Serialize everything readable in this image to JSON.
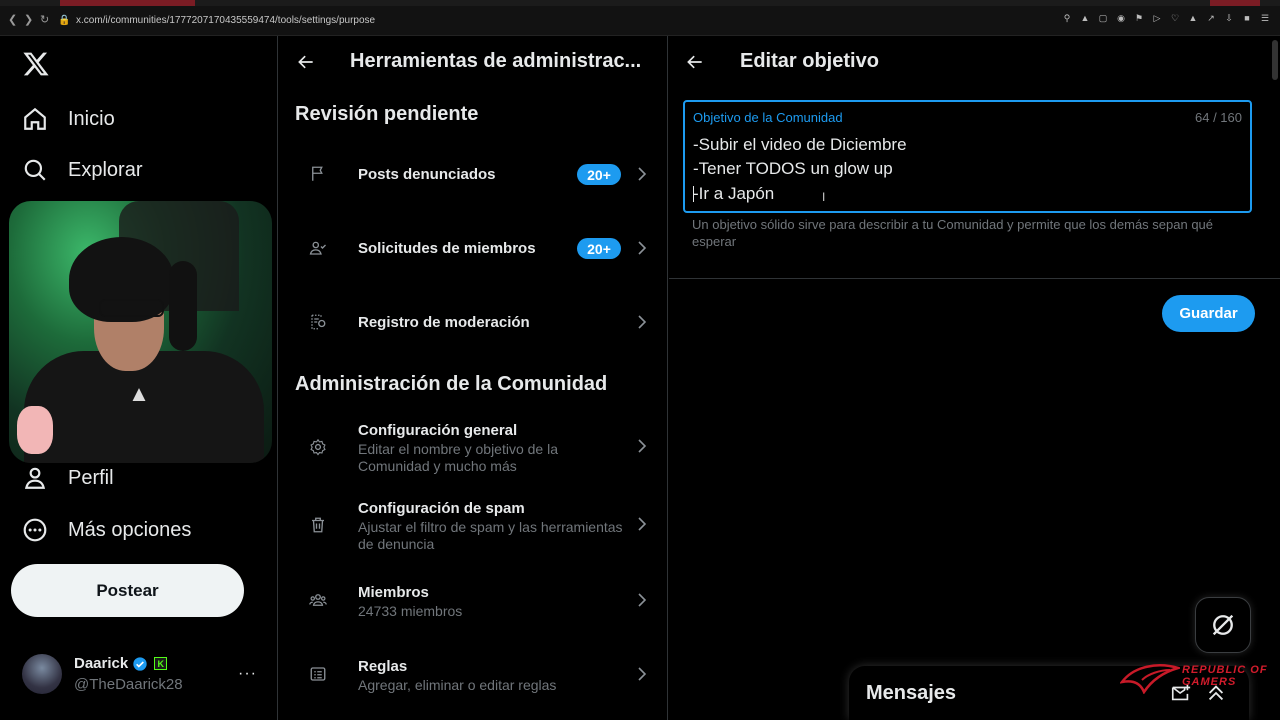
{
  "browser": {
    "url": "x.com/i/communities/1777207170435559474/tools/settings/purpose"
  },
  "sidebar": {
    "nav": [
      {
        "label": "Inicio",
        "icon": "home-icon"
      },
      {
        "label": "Explorar",
        "icon": "search-icon"
      },
      {
        "label": "Perfil",
        "icon": "person-icon"
      },
      {
        "label": "Más opciones",
        "icon": "more-circle-icon"
      }
    ],
    "post_label": "Postear",
    "account": {
      "name": "Daarick",
      "handle": "@TheDaarick28",
      "badge_letter": "K",
      "more": "···"
    }
  },
  "middle": {
    "title": "Herramientas de administrac...",
    "section_pending": "Revisión pendiente",
    "pending_rows": [
      {
        "title": "Posts denunciados",
        "badge": "20+",
        "icon": "flag-icon"
      },
      {
        "title": "Solicitudes de miembros",
        "badge": "20+",
        "icon": "person-check-icon"
      },
      {
        "title": "Registro de moderación",
        "badge": "",
        "icon": "moderation-log-icon"
      }
    ],
    "section_admin": "Administración de la Comunidad",
    "admin_rows": [
      {
        "title": "Configuración general",
        "subtitle": "Editar el nombre y objetivo de la Comunidad y mucho más",
        "icon": "gear-icon"
      },
      {
        "title": "Configuración de spam",
        "subtitle": "Ajustar el filtro de spam y las herramientas de denuncia",
        "icon": "trash-icon"
      },
      {
        "title": "Miembros",
        "subtitle": "24733 miembros",
        "icon": "people-icon"
      },
      {
        "title": "Reglas",
        "subtitle": "Agregar, eliminar o editar reglas",
        "icon": "rules-icon"
      }
    ]
  },
  "right": {
    "title": "Editar objetivo",
    "field": {
      "label": "Objetivo de la Comunidad",
      "count": "64 / 160",
      "lines": [
        "-Subir el video de Diciembre",
        "-Tener TODOS un glow up",
        "-Ir a Japón"
      ]
    },
    "help": "Un objetivo sólido sirve para describir a tu Comunidad y permite que los demás sepan qué esperar",
    "save_label": "Guardar"
  },
  "messages": {
    "title": "Mensajes"
  },
  "watermark": {
    "line1": "REPUBLIC OF",
    "line2": "GAMERS"
  },
  "colors": {
    "accent": "#1d9bf0",
    "background": "#000000",
    "text": "#e7e9ea",
    "muted": "#71767b",
    "border": "#2f3336"
  }
}
